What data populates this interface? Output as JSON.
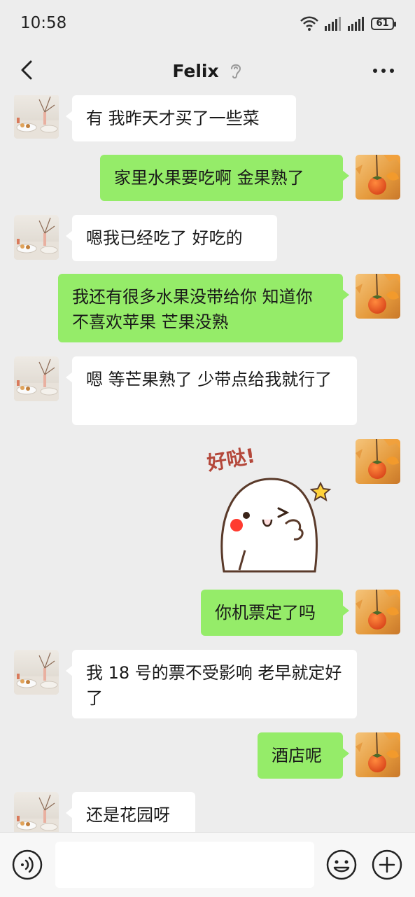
{
  "status": {
    "time": "10:58",
    "battery": "61"
  },
  "header": {
    "title": "Felix"
  },
  "messages": [
    {
      "from": "them",
      "text": "有 我昨天才买了一些菜"
    },
    {
      "from": "me",
      "text": "家里水果要吃啊 金果熟了"
    },
    {
      "from": "them",
      "text": "嗯我已经吃了 好吃的"
    },
    {
      "from": "me",
      "text": "我还有很多水果没带给你 知道你不喜欢苹果 芒果没熟"
    },
    {
      "from": "them",
      "text": "嗯 等芒果熟了 少带点给我就行了"
    },
    {
      "from": "me",
      "sticker": "好哒!"
    },
    {
      "from": "me",
      "text": "你机票定了吗"
    },
    {
      "from": "them",
      "text": "我 18 号的票不受影响 老早就定好了"
    },
    {
      "from": "me",
      "text": "酒店呢"
    },
    {
      "from": "them",
      "text": "还是花园呀"
    }
  ],
  "icons": {
    "back": "back-arrow-icon",
    "ear": "ear-icon",
    "more": "more-dots-icon",
    "voice": "voice-icon",
    "emoji": "emoji-icon",
    "plus": "plus-icon"
  },
  "colors": {
    "outgoing_bubble": "#95ec69",
    "incoming_bubble": "#ffffff",
    "background": "#ededed"
  }
}
